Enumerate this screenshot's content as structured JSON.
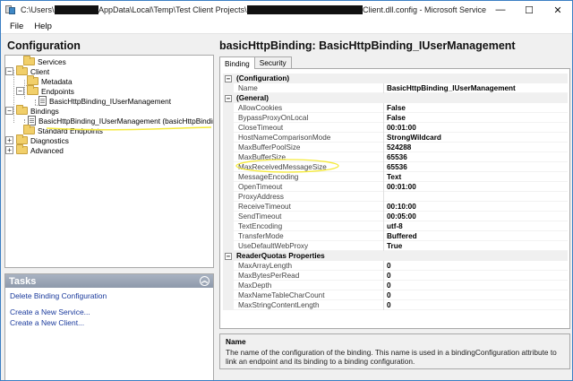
{
  "window": {
    "title_prefix": "C:\\Users\\",
    "title_middle": "AppData\\Local\\Temp\\Test Client Projects\\",
    "title_suffix": "Client.dll.config - Microsoft Service",
    "minimize_glyph": "—",
    "maximize_glyph": "☐",
    "close_glyph": "✕"
  },
  "menu": {
    "file": "File",
    "help": "Help"
  },
  "left": {
    "header": "Configuration",
    "tree": {
      "services": "Services",
      "client": "Client",
      "metadata": "Metadata",
      "endpoints": "Endpoints",
      "endpoint_item": "BasicHttpBinding_IUserManagement",
      "bindings": "Bindings",
      "binding_item": "BasicHttpBinding_IUserManagement (basicHttpBinding)",
      "standard_endpoints": "Standard Endpoints",
      "diagnostics": "Diagnostics",
      "advanced": "Advanced"
    },
    "tasks": {
      "header": "Tasks",
      "links": [
        "Delete Binding Configuration",
        "Create a New Service...",
        "Create a New Client..."
      ]
    }
  },
  "right": {
    "title": "basicHttpBinding: BasicHttpBinding_IUserManagement",
    "tabs": [
      "Binding",
      "Security"
    ],
    "grid": {
      "configuration": {
        "label": "(Configuration)",
        "rows": [
          {
            "name": "Name",
            "value": "BasicHttpBinding_IUserManagement"
          }
        ]
      },
      "general": {
        "label": "(General)",
        "rows": [
          {
            "name": "AllowCookies",
            "value": "False"
          },
          {
            "name": "BypassProxyOnLocal",
            "value": "False"
          },
          {
            "name": "CloseTimeout",
            "value": "00:01:00"
          },
          {
            "name": "HostNameComparisonMode",
            "value": "StrongWildcard"
          },
          {
            "name": "MaxBufferPoolSize",
            "value": "524288"
          },
          {
            "name": "MaxBufferSize",
            "value": "65536"
          },
          {
            "name": "MaxReceivedMessageSize",
            "value": "65536"
          },
          {
            "name": "MessageEncoding",
            "value": "Text"
          },
          {
            "name": "OpenTimeout",
            "value": "00:01:00"
          },
          {
            "name": "ProxyAddress",
            "value": ""
          },
          {
            "name": "ReceiveTimeout",
            "value": "00:10:00"
          },
          {
            "name": "SendTimeout",
            "value": "00:05:00"
          },
          {
            "name": "TextEncoding",
            "value": "utf-8"
          },
          {
            "name": "TransferMode",
            "value": "Buffered"
          },
          {
            "name": "UseDefaultWebProxy",
            "value": "True"
          }
        ]
      },
      "reader_quotas": {
        "label": "ReaderQuotas Properties",
        "rows": [
          {
            "name": "MaxArrayLength",
            "value": "0"
          },
          {
            "name": "MaxBytesPerRead",
            "value": "0"
          },
          {
            "name": "MaxDepth",
            "value": "0"
          },
          {
            "name": "MaxNameTableCharCount",
            "value": "0"
          },
          {
            "name": "MaxStringContentLength",
            "value": "0"
          }
        ]
      }
    },
    "description": {
      "title": "Name",
      "text": "The name of the configuration of the binding. This name is used in a bindingConfiguration attribute to link an endpoint and its binding to a binding configuration."
    }
  },
  "colors": {
    "highlight": "#f5ea3a",
    "link": "#1a3a9c",
    "title_border": "#3b7fc4"
  }
}
